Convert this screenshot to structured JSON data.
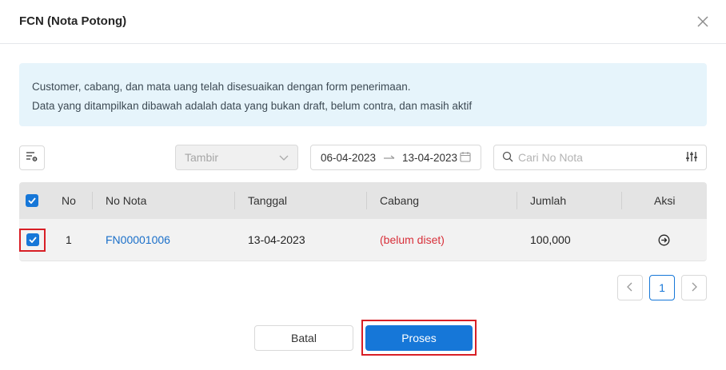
{
  "dialog": {
    "title": "FCN (Nota Potong)"
  },
  "alert": {
    "line1": "Customer, cabang, dan mata uang telah disesuaikan dengan form penerimaan.",
    "line2": "Data yang ditampilkan dibawah adalah data yang bukan draft, belum contra, dan masih aktif"
  },
  "filters": {
    "select_placeholder": "Tambir",
    "date_from": "06-04-2023",
    "date_to": "13-04-2023",
    "search_placeholder": "Cari No Nota"
  },
  "table": {
    "columns": [
      "No",
      "No Nota",
      "Tanggal",
      "Cabang",
      "Jumlah",
      "Aksi"
    ],
    "rows": [
      {
        "no": "1",
        "no_nota": "FN00001006",
        "tanggal": "13-04-2023",
        "cabang": "(belum diset)",
        "jumlah": "100,000",
        "selected": true
      }
    ]
  },
  "pagination": {
    "current_page": "1"
  },
  "footer": {
    "cancel_label": "Batal",
    "submit_label": "Proses"
  },
  "colors": {
    "primary": "#1677d8",
    "highlight": "#d81f26",
    "link": "#1a6fc9",
    "danger_text": "#d8303a"
  },
  "icons": {
    "close": "close-icon",
    "column_settings": "column-settings-icon",
    "dropdown": "chevron-down-icon",
    "date_arrow": "arrow-right-icon",
    "calendar": "calendar-icon",
    "search": "search-icon",
    "filter": "filter-sliders-icon",
    "action": "arrow-circle-right-icon",
    "prev": "chevron-left-icon",
    "next": "chevron-right-icon"
  }
}
